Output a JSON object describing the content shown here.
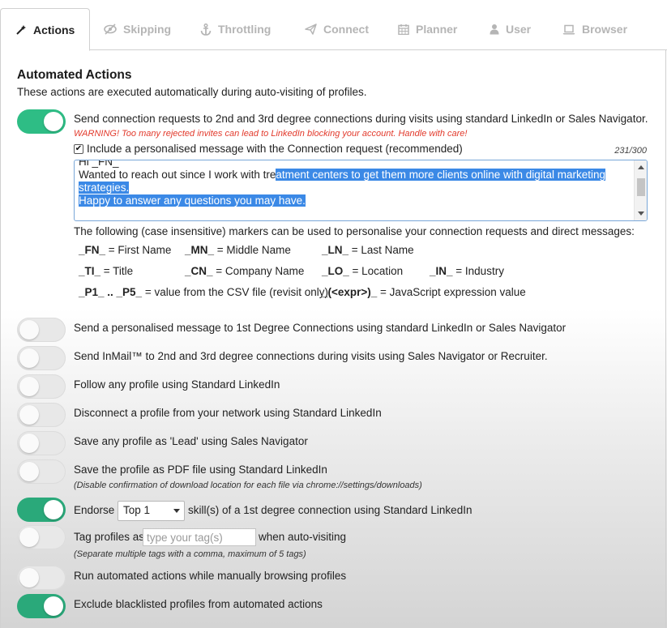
{
  "tabs": [
    {
      "label": "Actions",
      "icon": "magic-wand-icon",
      "active": true
    },
    {
      "label": "Skipping",
      "icon": "eye-slash-icon",
      "active": false
    },
    {
      "label": "Throttling",
      "icon": "anchor-icon",
      "active": false
    },
    {
      "label": "Connect",
      "icon": "paper-plane-icon",
      "active": false
    },
    {
      "label": "Planner",
      "icon": "calendar-icon",
      "active": false
    },
    {
      "label": "User",
      "icon": "user-icon",
      "active": false
    },
    {
      "label": "Browser",
      "icon": "laptop-icon",
      "active": false
    }
  ],
  "section": {
    "title": "Automated Actions",
    "description": "These actions are executed automatically during auto-visiting of profiles."
  },
  "connect": {
    "enabled": true,
    "label": "Send connection requests to 2nd and 3rd degree connections during visits using standard LinkedIn or Sales Navigator.",
    "warning": "WARNING! Too many rejected invites can lead to LinkedIn blocking your account. Handle with care!",
    "include_message_checked": true,
    "include_message_label": "Include a personalised message with the Connection request (recommended)",
    "counter": "231/300",
    "message": {
      "line1": "Hi _FN_",
      "line2_plain": "Wanted to reach out since I work with tre",
      "line2_selected": "atment centers to get them more clients online with digital marketing",
      "line3_selected": "strategies.",
      "line4_selected": "Happy to answer any questions you may have."
    }
  },
  "markers": {
    "intro": "The following (case insensitive) markers can be used to personalise your connection requests and direct messages:",
    "items": [
      {
        "code": "_FN_",
        "desc": " = First Name"
      },
      {
        "code": "_MN_",
        "desc": " = Middle Name"
      },
      {
        "code": "_LN_",
        "desc": " = Last Name"
      },
      {
        "code": "_TI_",
        "desc": " = Title"
      },
      {
        "code": "_CN_",
        "desc": " = Company Name"
      },
      {
        "code": "_LO_",
        "desc": " = Location"
      },
      {
        "code": "_IN_",
        "desc": " = Industry"
      },
      {
        "code": "_P1_ .. _P5_",
        "desc": " = value from the CSV file (revisit only)"
      },
      {
        "code": "_(<expr>)_",
        "desc": " = JavaScript expression value"
      }
    ]
  },
  "options": {
    "message_1st": {
      "enabled": false,
      "label": "Send a personalised message to 1st Degree Connections using standard LinkedIn or Sales Navigator"
    },
    "inmail": {
      "enabled": false,
      "label": "Send InMail™ to 2nd and 3rd degree connections during visits using Sales Navigator or Recruiter."
    },
    "follow": {
      "enabled": false,
      "label": "Follow any profile using Standard LinkedIn"
    },
    "disconnect": {
      "enabled": false,
      "label": "Disconnect a profile from your network using Standard LinkedIn"
    },
    "save_lead": {
      "enabled": false,
      "label": "Save any profile as 'Lead' using Sales Navigator"
    },
    "save_pdf": {
      "enabled": false,
      "label": "Save the profile as PDF file using Standard LinkedIn",
      "note": "(Disable confirmation of download location for each file via chrome://settings/downloads)"
    },
    "endorse": {
      "enabled": true,
      "label_before": "Endorse",
      "select_value": "Top 1",
      "label_after": "skill(s) of a 1st degree connection using Standard LinkedIn"
    },
    "tag": {
      "enabled": false,
      "label_before": "Tag profiles as",
      "placeholder": "type your tag(s)",
      "label_after": "when auto-visiting",
      "note": "(Separate multiple tags with a comma, maximum of 5 tags)"
    },
    "manual_browse": {
      "enabled": false,
      "label": "Run automated actions while manually browsing profiles"
    },
    "exclude_blacklisted": {
      "enabled": true,
      "label": "Exclude blacklisted profiles from automated actions"
    }
  }
}
